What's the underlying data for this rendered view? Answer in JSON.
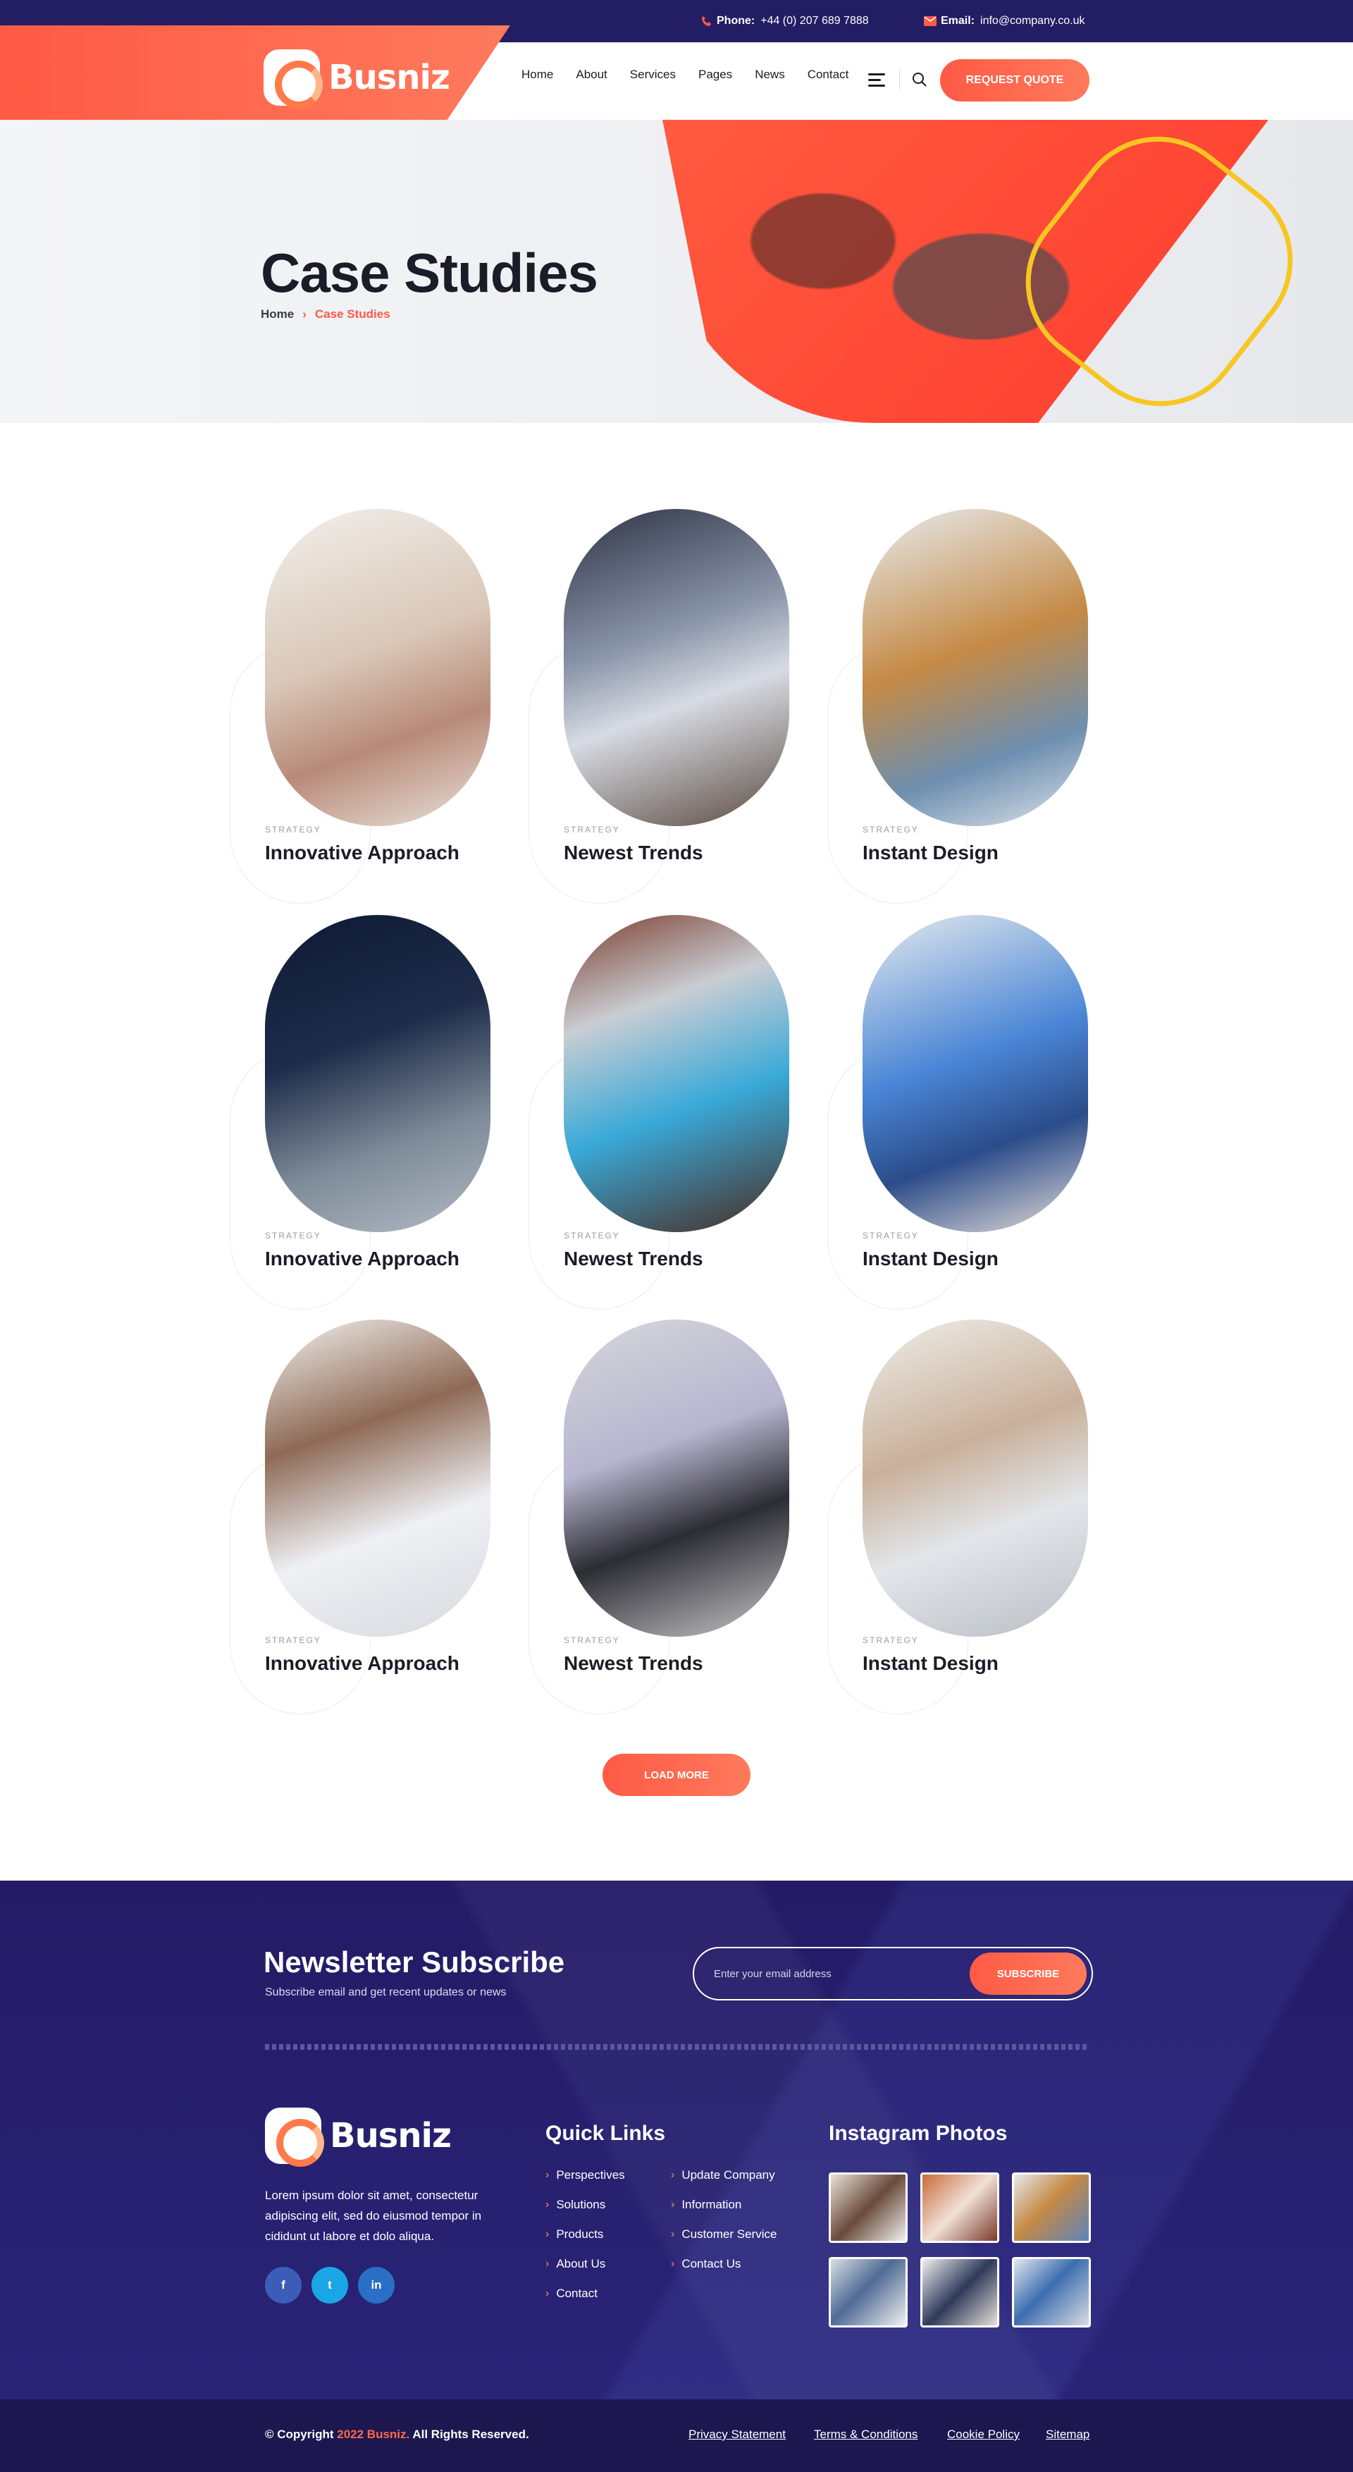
{
  "topbar": {
    "phone_label": "Phone:",
    "phone_value": "+44 (0) 207 689 7888",
    "email_label": "Email:",
    "email_value": "info@company.co.uk"
  },
  "brand": {
    "name": "Busniz"
  },
  "nav": {
    "items": [
      "Home",
      "About",
      "Services",
      "Pages",
      "News",
      "Contact"
    ],
    "cta": "REQUEST QUOTE"
  },
  "hero": {
    "title": "Case Studies",
    "breadcrumb": {
      "home": "Home",
      "separator": "›",
      "current": "Case Studies"
    }
  },
  "cases": [
    {
      "category": "STRATEGY",
      "title": "Innovative Approach"
    },
    {
      "category": "STRATEGY",
      "title": "Newest Trends"
    },
    {
      "category": "STRATEGY",
      "title": "Instant Design"
    },
    {
      "category": "STRATEGY",
      "title": "Innovative Approach"
    },
    {
      "category": "STRATEGY",
      "title": "Newest Trends"
    },
    {
      "category": "STRATEGY",
      "title": "Instant Design"
    },
    {
      "category": "STRATEGY",
      "title": "Innovative Approach"
    },
    {
      "category": "STRATEGY",
      "title": "Newest Trends"
    },
    {
      "category": "STRATEGY",
      "title": "Instant Design"
    }
  ],
  "load_more": "LOAD MORE",
  "newsletter": {
    "title": "Newsletter Subscribe",
    "subtitle": "Subscribe email and get recent updates or news",
    "placeholder": "Enter your email address",
    "button": "SUBSCRIBE"
  },
  "footer": {
    "about": "Lorem ipsum dolor sit amet, consectetur adipiscing elit, sed do eiusmod tempor in cididunt ut labore et dolo aliqua.",
    "social": [
      "f",
      "t",
      "in"
    ],
    "quick_links_title": "Quick Links",
    "quick_links_col1": [
      "Perspectives",
      "Solutions",
      "Products",
      "About Us",
      "Contact"
    ],
    "quick_links_col2": [
      "Update Company",
      "Information",
      "Customer Service",
      "Contact Us"
    ],
    "instagram_title": "Instagram Photos"
  },
  "bottom": {
    "copy_prefix": "© Copyright",
    "copy_highlight": "2022 Busniz.",
    "copy_suffix": "All Rights Reserved.",
    "links": [
      "Privacy Statement",
      "Terms & Conditions",
      "Cookie Policy",
      "Sitemap"
    ]
  },
  "colors": {
    "accent": "#ff5a45",
    "navy": "#231d63",
    "ring": "#f6c623"
  }
}
